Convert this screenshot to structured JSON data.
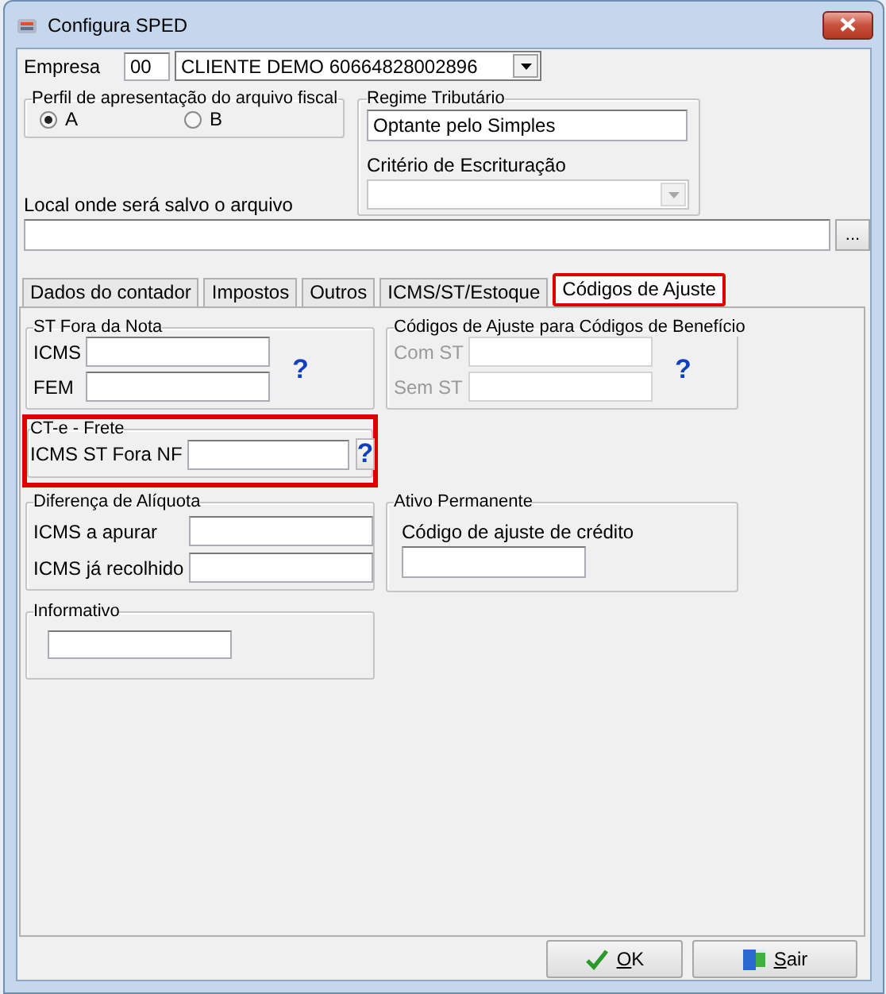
{
  "window": {
    "title": "Configura SPED"
  },
  "empresa": {
    "label": "Empresa",
    "code": "00",
    "name": "CLIENTE DEMO 60664828002896"
  },
  "perfil": {
    "title": "Perfil de apresentação do arquivo fiscal",
    "options": [
      {
        "label": "A",
        "selected": true
      },
      {
        "label": "B",
        "selected": false
      }
    ]
  },
  "regime": {
    "title": "Regime Tributário",
    "value": "Optante pelo Simples",
    "criterio_label": "Critério de Escrituração",
    "criterio_disabled": true
  },
  "local": {
    "label": "Local onde será salvo o arquivo",
    "browse": "..."
  },
  "tabs": [
    {
      "label": "Dados do contador",
      "selected": false,
      "highlighted": false
    },
    {
      "label": "Impostos",
      "selected": false,
      "highlighted": false
    },
    {
      "label": "Outros",
      "selected": false,
      "highlighted": false
    },
    {
      "label": "ICMS/ST/Estoque",
      "selected": false,
      "highlighted": false
    },
    {
      "label": "Códigos de Ajuste",
      "selected": true,
      "highlighted": true
    }
  ],
  "panel_rows": [
    [
      {
        "title": "ST Fora da Nota",
        "kind": "help-icon",
        "help": "?",
        "highlighted": false,
        "fields": [
          {
            "label": "ICMS",
            "disabled": false
          },
          {
            "label": "FEM",
            "disabled": false
          }
        ]
      },
      {
        "title": "Códigos de Ajuste para Códigos de Benefício",
        "kind": "help-icon",
        "help": "?",
        "highlighted": false,
        "fields": [
          {
            "label": "Com ST",
            "disabled": true
          },
          {
            "label": "Sem ST",
            "disabled": true
          }
        ]
      }
    ],
    [
      {
        "title": "CT-e - Frete",
        "kind": "help-button",
        "help": "?",
        "highlighted": true,
        "fields": [
          {
            "label": "ICMS ST Fora NF",
            "disabled": false
          }
        ]
      }
    ],
    [
      {
        "title": "Diferença de Alíquota",
        "kind": "inline",
        "highlighted": false,
        "fields": [
          {
            "label": "ICMS a apurar",
            "disabled": false
          },
          {
            "label": "ICMS já recolhido",
            "disabled": false
          }
        ]
      },
      {
        "title": "Ativo Permanente",
        "kind": "label-above",
        "highlighted": false,
        "fields": [
          {
            "label": "Código de ajuste de crédito",
            "disabled": false
          }
        ]
      }
    ],
    [
      {
        "title": "Informativo",
        "kind": "plain",
        "highlighted": false,
        "fields": [
          {
            "disabled": false
          }
        ]
      }
    ]
  ],
  "buttons": [
    {
      "label": "OK",
      "kind": "ok"
    },
    {
      "label": "Sair",
      "kind": "exit"
    }
  ]
}
